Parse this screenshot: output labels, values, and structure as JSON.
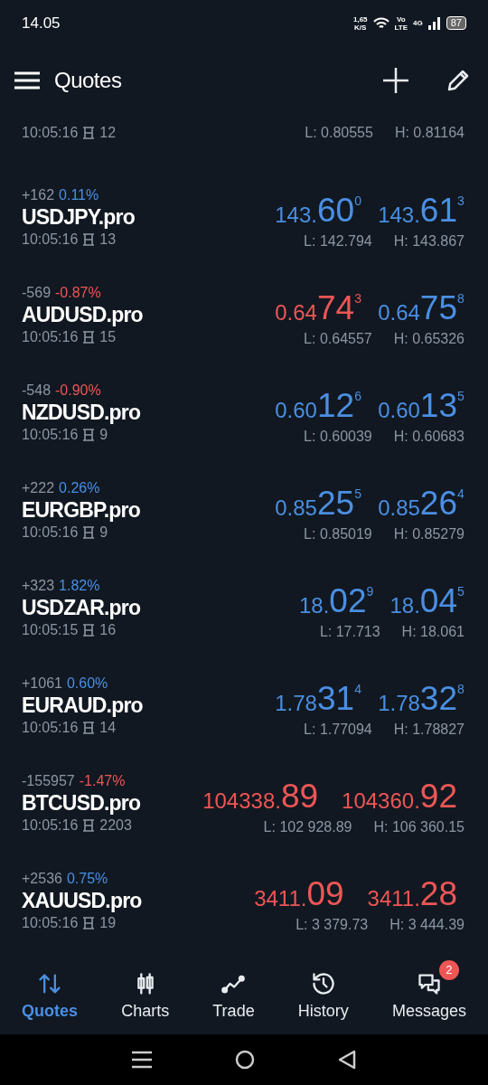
{
  "status_bar": {
    "time": "14.05",
    "speed": [
      "1,65",
      "K/S"
    ],
    "volte": [
      "Vo",
      "LTE"
    ],
    "network": "4G",
    "battery": "87"
  },
  "header": {
    "title": "Quotes"
  },
  "partial_row": {
    "time": "10:05:16",
    "spread": "12",
    "low": "L: 0.80555",
    "high": "H: 0.81164"
  },
  "quotes": [
    {
      "change": "+162",
      "percent": "0.11%",
      "rising": true,
      "symbol": "USDJPY.pro",
      "time": "10:05:16",
      "spread": "13",
      "bid": {
        "prefix": "143.",
        "big": "60",
        "sup": "0",
        "rising": true
      },
      "ask": {
        "prefix": "143.",
        "big": "61",
        "sup": "3",
        "rising": true
      },
      "low": "L: 142.794",
      "high": "H: 143.867"
    },
    {
      "change": "-569",
      "percent": "-0.87%",
      "rising": false,
      "symbol": "AUDUSD.pro",
      "time": "10:05:16",
      "spread": "15",
      "bid": {
        "prefix": "0.64",
        "big": "74",
        "sup": "3",
        "rising": false
      },
      "ask": {
        "prefix": "0.64",
        "big": "75",
        "sup": "8",
        "rising": true
      },
      "low": "L: 0.64557",
      "high": "H: 0.65326"
    },
    {
      "change": "-548",
      "percent": "-0.90%",
      "rising": false,
      "symbol": "NZDUSD.pro",
      "time": "10:05:16",
      "spread": "9",
      "bid": {
        "prefix": "0.60",
        "big": "12",
        "sup": "6",
        "rising": true
      },
      "ask": {
        "prefix": "0.60",
        "big": "13",
        "sup": "5",
        "rising": true
      },
      "low": "L: 0.60039",
      "high": "H: 0.60683"
    },
    {
      "change": "+222",
      "percent": "0.26%",
      "rising": true,
      "symbol": "EURGBP.pro",
      "time": "10:05:16",
      "spread": "9",
      "bid": {
        "prefix": "0.85",
        "big": "25",
        "sup": "5",
        "rising": true
      },
      "ask": {
        "prefix": "0.85",
        "big": "26",
        "sup": "4",
        "rising": true
      },
      "low": "L: 0.85019",
      "high": "H: 0.85279"
    },
    {
      "change": "+323",
      "percent": "1.82%",
      "rising": true,
      "symbol": "USDZAR.pro",
      "time": "10:05:15",
      "spread": "16",
      "bid": {
        "prefix": "18.",
        "big": "02",
        "sup": "9",
        "rising": true
      },
      "ask": {
        "prefix": "18.",
        "big": "04",
        "sup": "5",
        "rising": true
      },
      "low": "L: 17.713",
      "high": "H: 18.061"
    },
    {
      "change": "+1061",
      "percent": "0.60%",
      "rising": true,
      "symbol": "EURAUD.pro",
      "time": "10:05:16",
      "spread": "14",
      "bid": {
        "prefix": "1.78",
        "big": "31",
        "sup": "4",
        "rising": true
      },
      "ask": {
        "prefix": "1.78",
        "big": "32",
        "sup": "8",
        "rising": true
      },
      "low": "L: 1.77094",
      "high": "H: 1.78827"
    },
    {
      "change": "-155957",
      "percent": "-1.47%",
      "rising": false,
      "symbol": "BTCUSD.pro",
      "time": "10:05:16",
      "spread": "2203",
      "bid": {
        "prefix": "104338.",
        "big": "89",
        "rising": false
      },
      "ask": {
        "prefix": "104360.",
        "big": "92",
        "rising": false
      },
      "low": "L: 102 928.89",
      "high": "H: 106 360.15"
    },
    {
      "change": "+2536",
      "percent": "0.75%",
      "rising": true,
      "symbol": "XAUUSD.pro",
      "time": "10:05:16",
      "spread": "19",
      "bid": {
        "prefix": "3411.",
        "big": "09",
        "rising": false
      },
      "ask": {
        "prefix": "3411.",
        "big": "28",
        "rising": false
      },
      "low": "L: 3 379.73",
      "high": "H: 3 444.39"
    }
  ],
  "bottom_nav": [
    {
      "kind": "quotes",
      "label": "Quotes",
      "selected": true
    },
    {
      "kind": "charts",
      "label": "Charts",
      "selected": false
    },
    {
      "kind": "trade",
      "label": "Trade",
      "selected": false
    },
    {
      "kind": "history",
      "label": "History",
      "selected": false
    },
    {
      "kind": "messages",
      "label": "Messages",
      "selected": false,
      "badge": "2"
    }
  ]
}
